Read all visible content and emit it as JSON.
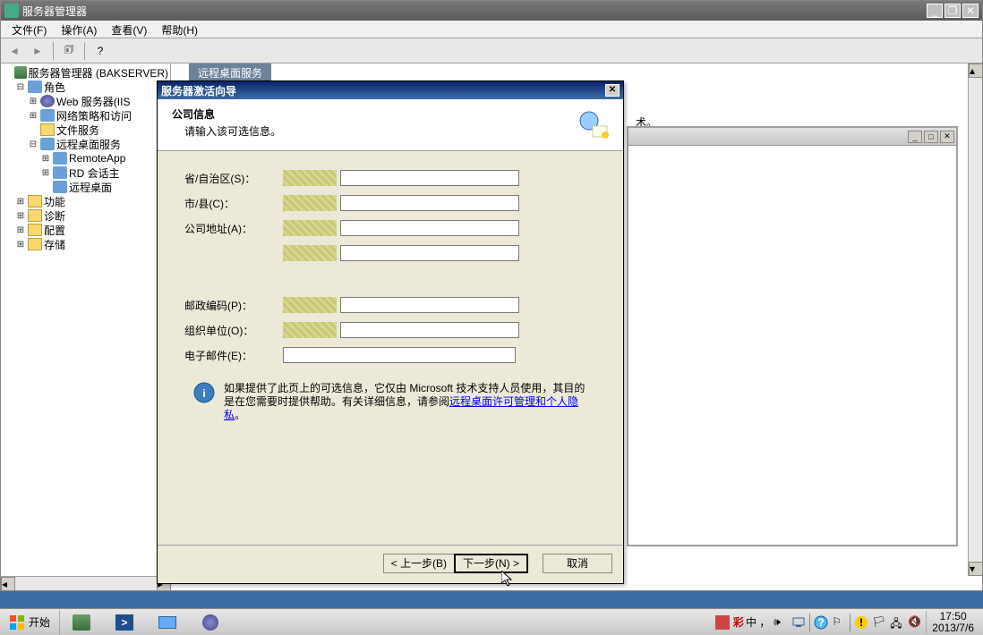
{
  "main_window": {
    "title": "服务器管理器"
  },
  "menu": {
    "file": "文件(F)",
    "action": "操作(A)",
    "view": "查看(V)",
    "help": "帮助(H)"
  },
  "tree": {
    "root": "服务器管理器 (BAKSERVER)",
    "roles": "角色",
    "web": "Web 服务器(IIS",
    "np": "网络策略和访问",
    "file": "文件服务",
    "rds": "远程桌面服务",
    "remoteapp": "RemoteApp",
    "rdsession": "RD 会话主",
    "rddesktop": "远程桌面",
    "features": "功能",
    "diag": "诊断",
    "config": "配置",
    "storage": "存储"
  },
  "tab": {
    "label": "远程桌面服务"
  },
  "bg_text": "术。",
  "wizard": {
    "title": "服务器激活向导",
    "header_title": "公司信息",
    "header_sub": "请输入该可选信息。",
    "labels": {
      "province": "省/自治区(S)：",
      "city": "市/县(C)：",
      "address": "公司地址(A)：",
      "postal": "邮政编码(P)：",
      "org": "组织单位(O)：",
      "email": "电子邮件(E)："
    },
    "info_text_1": "如果提供了此页上的可选信息，它仅由 Microsoft 技术支持人员使用，其目的是在您需要时提供帮助。有关详细信息，请参阅",
    "info_link": "远程桌面许可管理和个人隐私",
    "info_text_2": "。",
    "btn_back": "< 上一步(B)",
    "btn_next": "下一步(N) >",
    "btn_cancel": "取消"
  },
  "taskbar": {
    "start": "开始",
    "ime": "中 ，",
    "time": "17:50",
    "date": "2013/7/6"
  }
}
